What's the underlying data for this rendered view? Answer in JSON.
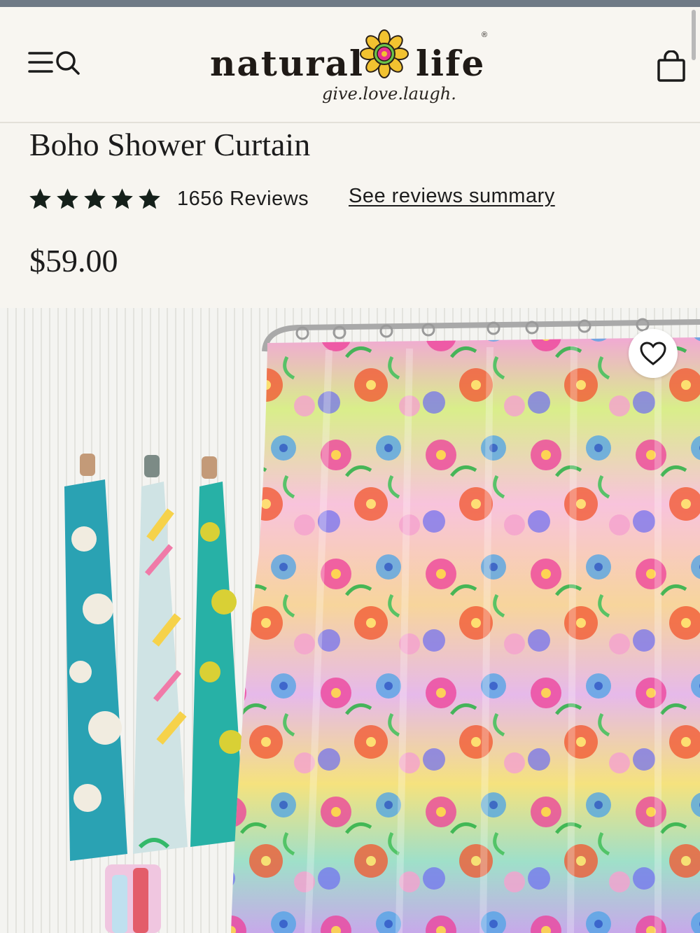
{
  "brand": {
    "logo_left": "natural",
    "logo_right": "life",
    "tagline": "give.love.laugh.",
    "registered_mark": "®"
  },
  "icons": {
    "menu": "menu-icon",
    "search": "search-icon",
    "cart": "shopping-bag-icon",
    "favorite": "heart-icon",
    "star": "star-icon"
  },
  "product": {
    "title": "Boho Shower Curtain",
    "rating": 5,
    "rating_max": 5,
    "reviews_label": "1656 Reviews",
    "summary_link": "See reviews summary",
    "price": "$59.00"
  },
  "colors": {
    "background": "#f7f5f0",
    "text": "#1d1d1d",
    "logo_flower_petals": "#f2c230",
    "logo_flower_center": "#e4318f"
  }
}
